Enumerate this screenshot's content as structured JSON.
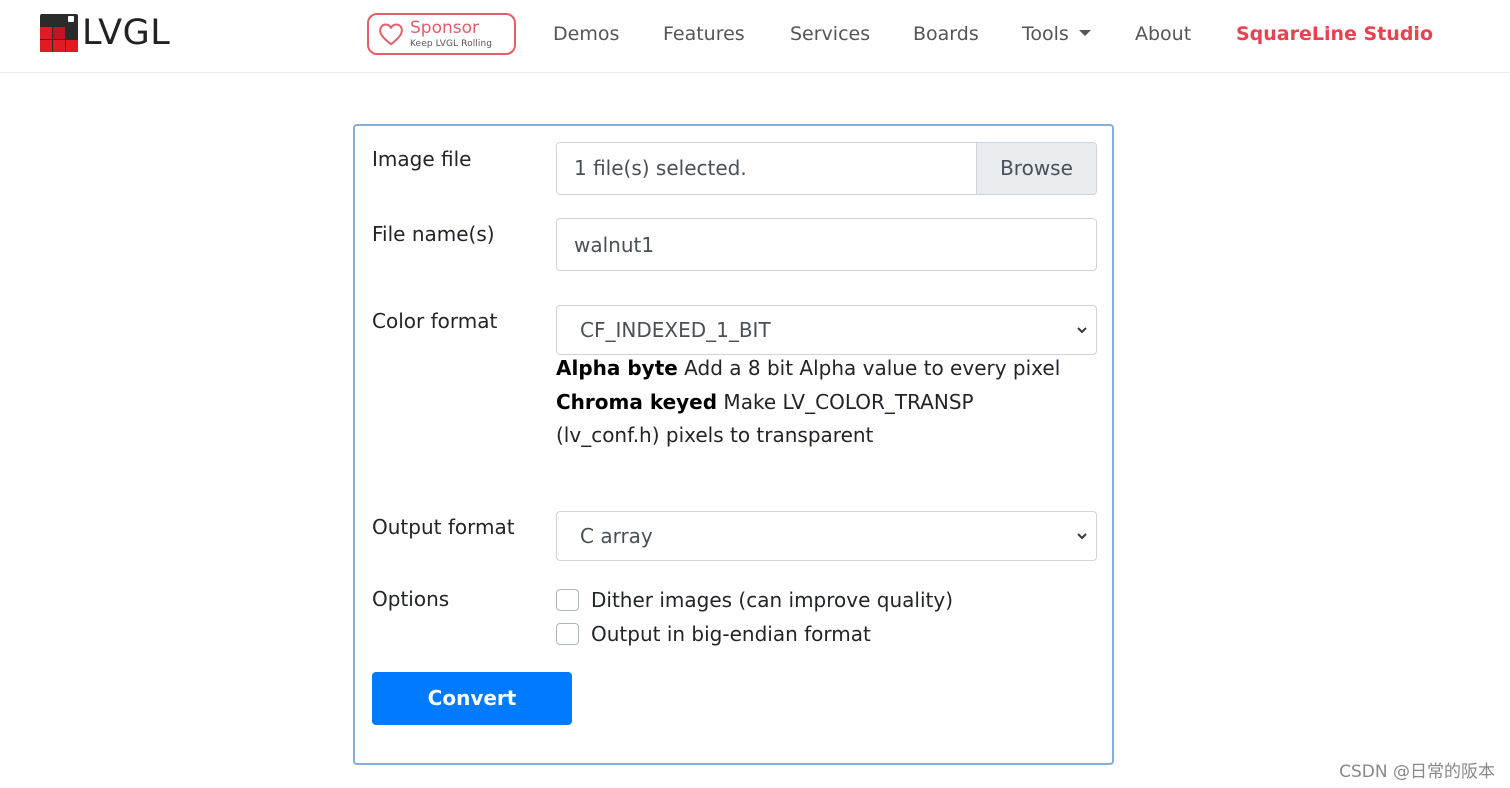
{
  "nav": {
    "logo_text": "LVGL",
    "sponsor": {
      "title": "Sponsor",
      "subtitle": "Keep LVGL Rolling"
    },
    "items": [
      {
        "label": "Demos"
      },
      {
        "label": "Features"
      },
      {
        "label": "Services"
      },
      {
        "label": "Boards"
      },
      {
        "label": "Tools",
        "has_dropdown": true
      },
      {
        "label": "About"
      },
      {
        "label": "SquareLine Studio",
        "accent": true
      }
    ]
  },
  "form": {
    "image_file": {
      "label": "Image file",
      "value": "1 file(s) selected.",
      "browse_label": "Browse"
    },
    "file_name": {
      "label": "File name(s)",
      "value": "walnut1"
    },
    "color_format": {
      "label": "Color format",
      "selected": "CF_INDEXED_1_BIT",
      "help": [
        {
          "term": "Alpha byte",
          "desc": " Add a 8 bit Alpha value to every pixel"
        },
        {
          "term": "Chroma keyed",
          "desc": " Make LV_COLOR_TRANSP (lv_conf.h) pixels to transparent"
        }
      ]
    },
    "output_format": {
      "label": "Output format",
      "selected": "C array"
    },
    "options": {
      "label": "Options",
      "items": [
        {
          "label": "Dither images (can improve quality)",
          "checked": false
        },
        {
          "label": "Output in big-endian format",
          "checked": false
        }
      ]
    },
    "convert_label": "Convert"
  },
  "watermark": "CSDN @日常的阪本",
  "colors": {
    "accent": "#e8414f",
    "primary": "#007bff",
    "card_border": "#86aed6"
  }
}
